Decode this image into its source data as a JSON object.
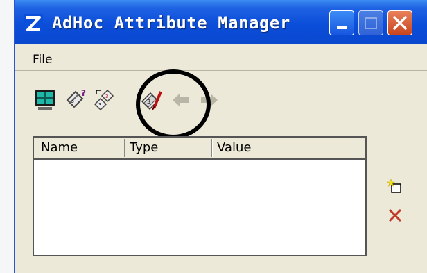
{
  "window": {
    "title": "AdHoc Attribute Manager",
    "title_color": "#ffffff",
    "titlebar_color": "#0b4ed9"
  },
  "menu": {
    "file_label": "File"
  },
  "toolbar": {
    "buttons": [
      {
        "icon": "monitor-grid-icon",
        "enabled": true
      },
      {
        "icon": "tag-query-icon",
        "enabled": true
      },
      {
        "icon": "tag-copy-icon",
        "enabled": true
      },
      {
        "icon": "tag-edit-icon",
        "enabled": true,
        "highlighted": true
      },
      {
        "icon": "arrow-left-icon",
        "enabled": false
      },
      {
        "icon": "arrow-right-icon",
        "enabled": false
      }
    ]
  },
  "attribute_list": {
    "columns": [
      "Name",
      "Type",
      "Value"
    ],
    "rows": []
  },
  "side_actions": [
    {
      "icon": "new-attribute-icon"
    },
    {
      "icon": "delete-icon",
      "color": "#c0392b"
    }
  ]
}
